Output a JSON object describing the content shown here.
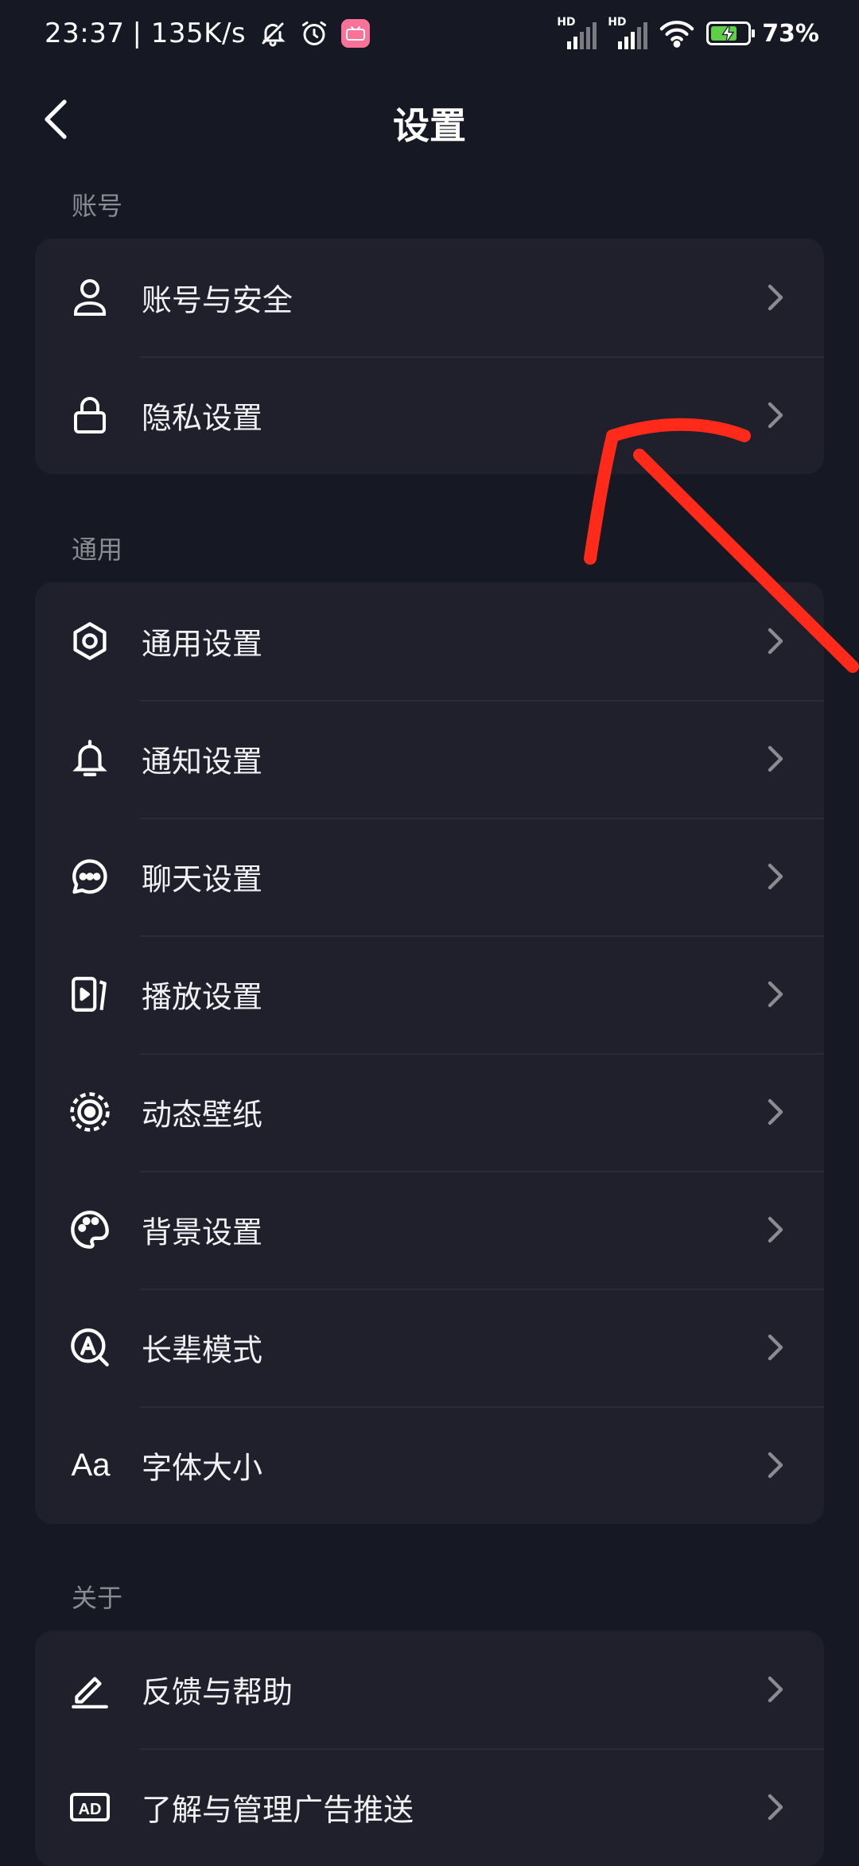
{
  "status_bar": {
    "time": "23:37",
    "speed": "| 135K/s",
    "signal_1_label": "HD",
    "signal_2_label": "HD",
    "battery_percent": "73%",
    "battery_level": 0.73,
    "battery_color": "#5fcf4a",
    "icons": [
      "bell-off-icon",
      "alarm-icon",
      "app-badge-icon",
      "signal-icon",
      "wifi-icon",
      "battery-charging-icon"
    ]
  },
  "header": {
    "title": "设置",
    "back_icon": "chevron-left-icon"
  },
  "sections": [
    {
      "label": "账号",
      "items": [
        {
          "label": "账号与安全",
          "icon": "user-icon"
        },
        {
          "label": "隐私设置",
          "icon": "lock-icon"
        }
      ]
    },
    {
      "label": "通用",
      "items": [
        {
          "label": "通用设置",
          "icon": "gear-icon"
        },
        {
          "label": "通知设置",
          "icon": "bell-icon"
        },
        {
          "label": "聊天设置",
          "icon": "chat-bubble-icon"
        },
        {
          "label": "播放设置",
          "icon": "play-icon"
        },
        {
          "label": "动态壁纸",
          "icon": "dynamic-wallpaper-icon"
        },
        {
          "label": "背景设置",
          "icon": "palette-icon"
        },
        {
          "label": "长辈模式",
          "icon": "elder-mode-icon"
        },
        {
          "label": "字体大小",
          "icon": "font-size-icon",
          "icon_text": "Aa"
        }
      ]
    },
    {
      "label": "关于",
      "items": [
        {
          "label": "反馈与帮助",
          "icon": "edit-icon"
        },
        {
          "label": "了解与管理广告推送",
          "icon": "ad-icon",
          "icon_text": "AD"
        }
      ]
    }
  ],
  "colors": {
    "background": "#161823",
    "card": "#1f202b",
    "annotation_arrow": "#ff2a1a"
  }
}
